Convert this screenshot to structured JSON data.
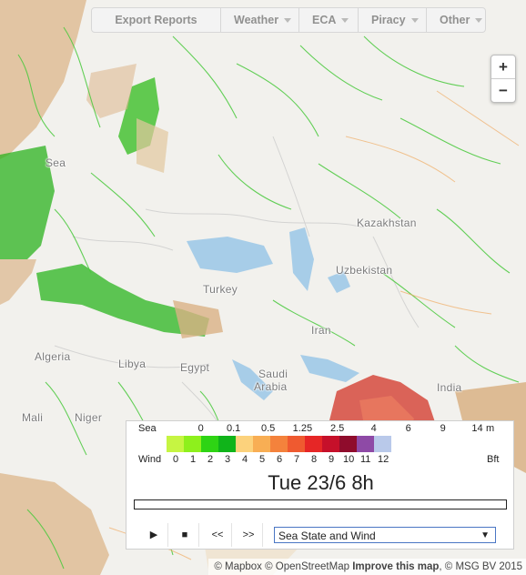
{
  "toolbar": {
    "export_reports": "Export Reports",
    "weather": "Weather",
    "eca": "ECA",
    "piracy": "Piracy",
    "other": "Other"
  },
  "zoom": {
    "zoom_in": "+",
    "zoom_out": "−"
  },
  "places": {
    "kazakhstan": "Kazakhstan",
    "uzbekistan": "Uzbekistan",
    "turkey": "Turkey",
    "iran": "Iran",
    "algeria": "Algeria",
    "libya": "Libya",
    "egypt": "Egypt",
    "saudi": "Saudi",
    "arabia": "Arabia",
    "india": "India",
    "mali": "Mali",
    "niger": "Niger",
    "sea_fragment": "Sea"
  },
  "legend": {
    "sea_label": "Sea",
    "sea_unit": "m",
    "sea_values": [
      "0",
      "0.1",
      "0.5",
      "1.25",
      "2.5",
      "4",
      "6",
      "9",
      "14"
    ],
    "wind_label": "Wind",
    "wind_unit": "Bft",
    "wind_values": [
      "0",
      "1",
      "2",
      "3",
      "4",
      "5",
      "6",
      "7",
      "8",
      "9",
      "10",
      "11",
      "12"
    ],
    "colors": [
      "#c6f542",
      "#8ef01c",
      "#2ed414",
      "#10b41a",
      "#fcd27c",
      "#f8ae54",
      "#f4823c",
      "#ef5a30",
      "#e62626",
      "#c6102a",
      "#8f0c2c",
      "#8e4aa6",
      "#b9c9ea"
    ]
  },
  "timeline": {
    "date": "Tue 23/6 8h",
    "progress": 0
  },
  "controls": {
    "play": "▶",
    "stop": "■",
    "back": "<<",
    "forward": ">>"
  },
  "layer_select": {
    "value": "Sea State and Wind"
  },
  "attribution": {
    "mapbox": "© Mapbox",
    "osm": "© OpenStreetMap",
    "improve": "Improve this map",
    "msg": ", © MSG BV 2015"
  }
}
